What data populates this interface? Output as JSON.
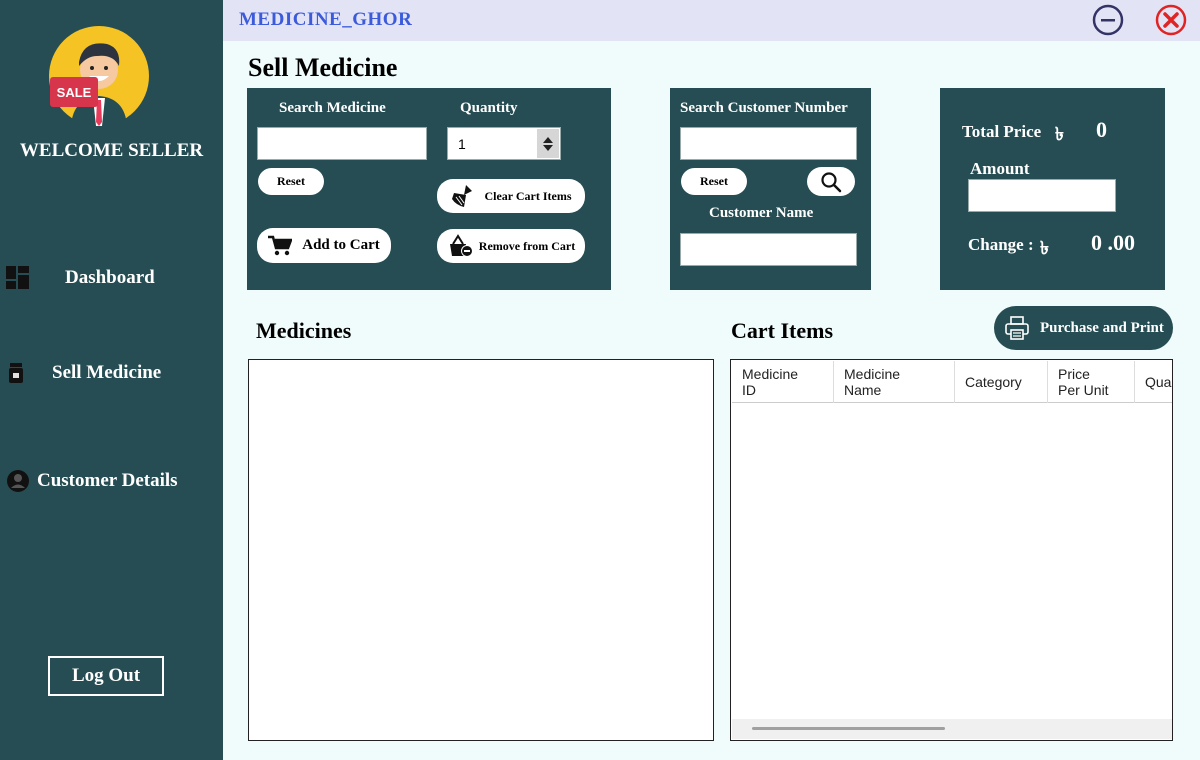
{
  "app": {
    "title": "MEDICINE_GHOR"
  },
  "sidebar": {
    "welcome": "WELCOME SELLER",
    "avatar_badge": "SALE",
    "items": [
      {
        "label": "Dashboard",
        "icon": "dashboard-icon"
      },
      {
        "label": "Sell Medicine",
        "icon": "medicine-bottle-icon"
      },
      {
        "label": "Customer Details",
        "icon": "user-circle-icon"
      }
    ],
    "logout": "Log Out"
  },
  "page": {
    "title": "Sell Medicine"
  },
  "medicine_panel": {
    "search_label": "Search Medicine",
    "search_value": "",
    "quantity_label": "Quantity",
    "quantity_value": "1",
    "reset_label": "Reset",
    "clear_cart_label": "Clear Cart Items",
    "add_to_cart_label": "Add to Cart",
    "remove_label": "Remove from Cart"
  },
  "customer_panel": {
    "search_label": "Search Customer Number",
    "search_value": "",
    "reset_label": "Reset",
    "name_label": "Customer Name",
    "name_value": ""
  },
  "price_panel": {
    "total_label": "Total Price",
    "currency": "৳",
    "total_value": "0",
    "amount_label": "Amount",
    "amount_value": "",
    "change_label": "Change :",
    "change_value": "0 .00"
  },
  "medicines": {
    "title": "Medicines"
  },
  "cart": {
    "title": "Cart Items",
    "columns": [
      "Medicine\nID",
      "Medicine\nName",
      "Category",
      "Price\nPer Unit",
      "Qua"
    ],
    "purchase_label": "Purchase and Print"
  },
  "colors": {
    "sidebar": "#264d53",
    "title_accent": "#3b5bdb",
    "close_red": "#e02424",
    "titlebar": "#e3e3f6"
  }
}
